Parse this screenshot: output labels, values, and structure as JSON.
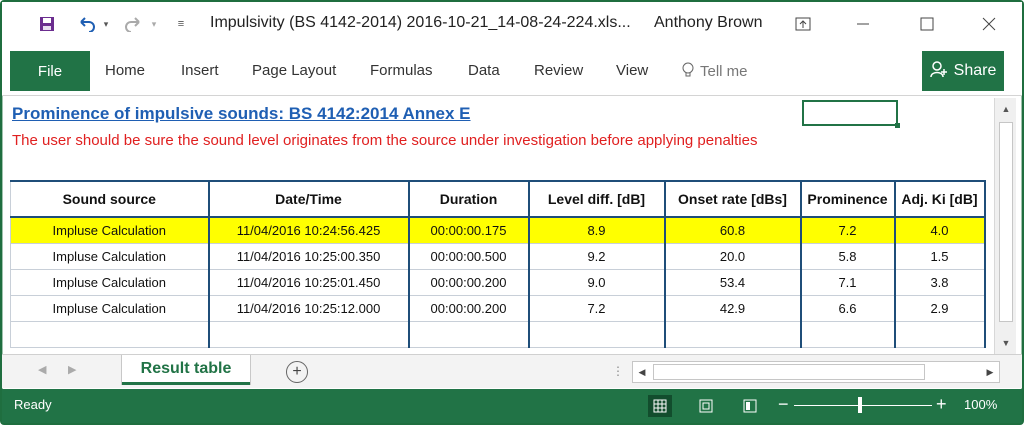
{
  "window": {
    "title": "Impulsivity (BS 4142-2014) 2016-10-21_14-08-24-224.xls...",
    "user": "Anthony Brown"
  },
  "ribbon": {
    "file_label": "File",
    "tabs": [
      "Home",
      "Insert",
      "Page Layout",
      "Formulas",
      "Data",
      "Review",
      "View"
    ],
    "tell_me": "Tell me",
    "share_label": "Share"
  },
  "sheet": {
    "heading": "Prominence of impulsive sounds: BS 4142:2014 Annex E",
    "warning": "The user should be sure the sound level originates from the source under investigation before applying penalties",
    "table": {
      "headers": [
        "Sound source",
        "Date/Time",
        "Duration",
        "Level diff. [dB]",
        "Onset rate [dBs]",
        "Prominence",
        "Adj. Ki [dB]"
      ],
      "rows": [
        [
          "Impluse Calculation",
          "11/04/2016 10:24:56.425",
          "00:00:00.175",
          "8.9",
          "60.8",
          "7.2",
          "4.0"
        ],
        [
          "Impluse Calculation",
          "11/04/2016 10:25:00.350",
          "00:00:00.500",
          "9.2",
          "20.0",
          "5.8",
          "1.5"
        ],
        [
          "Impluse Calculation",
          "11/04/2016 10:25:01.450",
          "00:00:00.200",
          "9.0",
          "53.4",
          "7.1",
          "3.8"
        ],
        [
          "Impluse Calculation",
          "11/04/2016 10:25:12.000",
          "00:00:00.200",
          "7.2",
          "42.9",
          "6.6",
          "2.9"
        ]
      ],
      "highlight_color": "#ffff00"
    }
  },
  "tabs": {
    "active_sheet": "Result table"
  },
  "status": {
    "text": "Ready",
    "zoom": "100%"
  },
  "colors": {
    "accent": "#217346",
    "heading": "#1f5fb3",
    "warning": "#e02020"
  }
}
